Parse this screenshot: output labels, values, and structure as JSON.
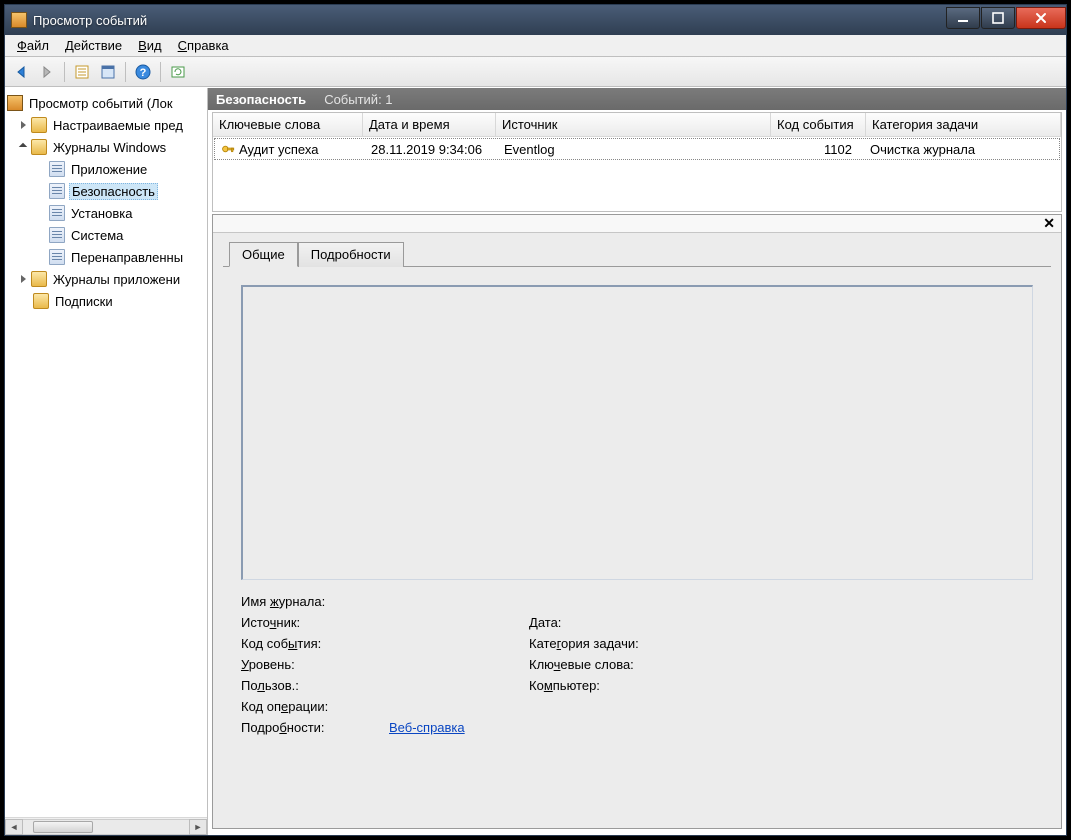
{
  "window": {
    "title": "Просмотр событий"
  },
  "menu": {
    "file": "Файл",
    "action": "Действие",
    "view": "Вид",
    "help": "Справка"
  },
  "tree": {
    "root": "Просмотр событий (Лок",
    "custom": "Настраиваемые пред",
    "winlogs": "Журналы Windows",
    "logs": {
      "app": "Приложение",
      "security": "Безопасность",
      "setup": "Установка",
      "system": "Система",
      "forwarded": "Перенаправленны"
    },
    "applogs": "Журналы приложени",
    "subs": "Подписки"
  },
  "strip": {
    "title": "Безопасность",
    "count": "Событий: 1"
  },
  "cols": {
    "keywords": "Ключевые слова",
    "datetime": "Дата и время",
    "source": "Источник",
    "code": "Код события",
    "task": "Категория задачи"
  },
  "events": [
    {
      "keywords": "Аудит успеха",
      "datetime": "28.11.2019 9:34:06",
      "source": "Eventlog",
      "code": "1102",
      "task": "Очистка журнала"
    }
  ],
  "tabs": {
    "general": "Общие",
    "details": "Подробности"
  },
  "labels": {
    "logname": "Имя журнала:",
    "source": "Источник:",
    "date": "Дата:",
    "eventid": "Код события:",
    "taskcat": "Категория задачи:",
    "level": "Уровень:",
    "keywords": "Ключевые слова:",
    "user": "Пользов.:",
    "computer": "Компьютер:",
    "opcode": "Код операции:",
    "moreinfo": "Подробности:",
    "helplink": "Веб-справка "
  }
}
